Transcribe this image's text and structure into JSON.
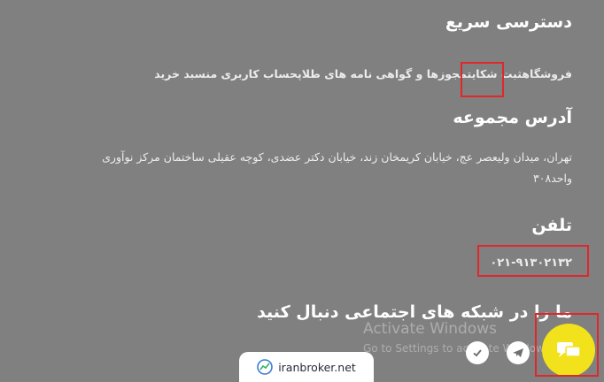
{
  "quick_access": {
    "title": "دسترسی سریع",
    "links": [
      "فروشگاه",
      "ثبت شکایت",
      "مجوزها و گواهی نامه های طلا",
      "پ",
      "حساب کاربری من",
      "سبد خرید"
    ]
  },
  "address": {
    "title": "آدرس مجموعه",
    "line1": "تهران، میدان ولیعصر عج، خیابان کریمخان زند، خیابان دکتر عضدی، کوچه عقیلی ساختمان مرکز نوآوری",
    "line2": "واحد۳۰۸"
  },
  "phone": {
    "title": "تلفن",
    "number": "۰۲۱-۹۱۳۰۲۱۳۲"
  },
  "social": {
    "title": "ما را در شبکه های اجتماعی دنبال کنید"
  },
  "watermark": {
    "line1": "Activate Windows",
    "line2": "Go to Settings to activate Windows."
  },
  "brand": {
    "text": "iranbroker.net"
  },
  "colors": {
    "background": "#808080",
    "highlight": "#e0272b",
    "fab": "#f2e21c"
  }
}
